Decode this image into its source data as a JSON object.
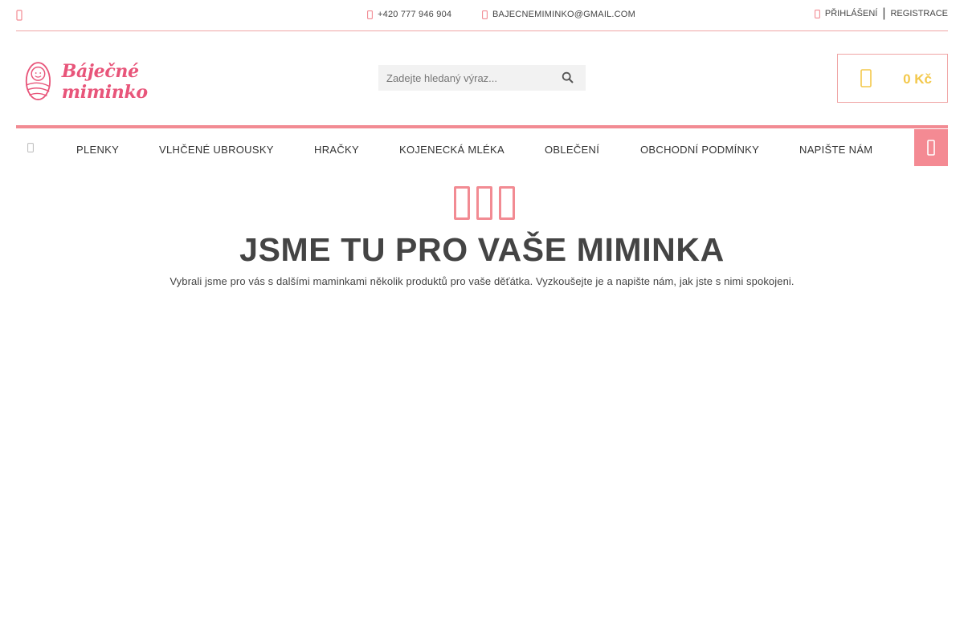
{
  "topbar": {
    "phone": "+420 777 946 904",
    "email": "BAJECNEMIMINKO@GMAIL.COM",
    "login": "PŘIHLÁŠENÍ",
    "separator": "|",
    "register": "REGISTRACE"
  },
  "header": {
    "logo_text": "Báječné miminko",
    "search_placeholder": "Zadejte hledaný výraz...",
    "cart_total": "0 Kč"
  },
  "nav": {
    "items": [
      "PLENKY",
      "VLHČENÉ UBROUSKY",
      "HRAČKY",
      "KOJENECKÁ MLÉKA",
      "OBLEČENÍ",
      "OBCHODNÍ PODMÍNKY",
      "NAPIŠTE NÁM"
    ]
  },
  "hero": {
    "title": "JSME TU PRO VAŠE MIMINKA",
    "subtitle": "Vybrali jsme pro vás s dalšími maminkami několik produktů pro vaše děťátka. Vyzkoušejte je a napište nám, jak jste s nimi spokojeni."
  },
  "icons": {
    "top_left": "facebook-icon",
    "phone": "phone-icon",
    "email": "envelope-icon",
    "login": "user-icon",
    "search": "search-icon",
    "cart": "shopping-bag-icon",
    "home": "home-icon",
    "user_button": "user-icon"
  },
  "colors": {
    "accent_pink": "#f28b93",
    "logo_pink": "#e8557a",
    "cart_yellow": "#f3c84b",
    "text": "#444444"
  }
}
